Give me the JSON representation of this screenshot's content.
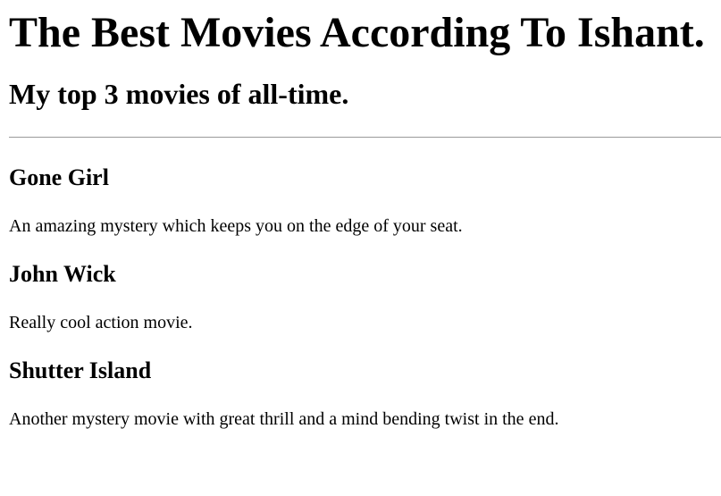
{
  "page": {
    "title": "The Best Movies According To Ishant.",
    "subtitle": "My top 3 movies of all-time."
  },
  "movies": [
    {
      "title": "Gone Girl",
      "description": "An amazing mystery which keeps you on the edge of your seat."
    },
    {
      "title": "John Wick",
      "description": "Really cool action movie."
    },
    {
      "title": "Shutter Island",
      "description": "Another mystery movie with great thrill and a mind bending twist in the end."
    }
  ]
}
